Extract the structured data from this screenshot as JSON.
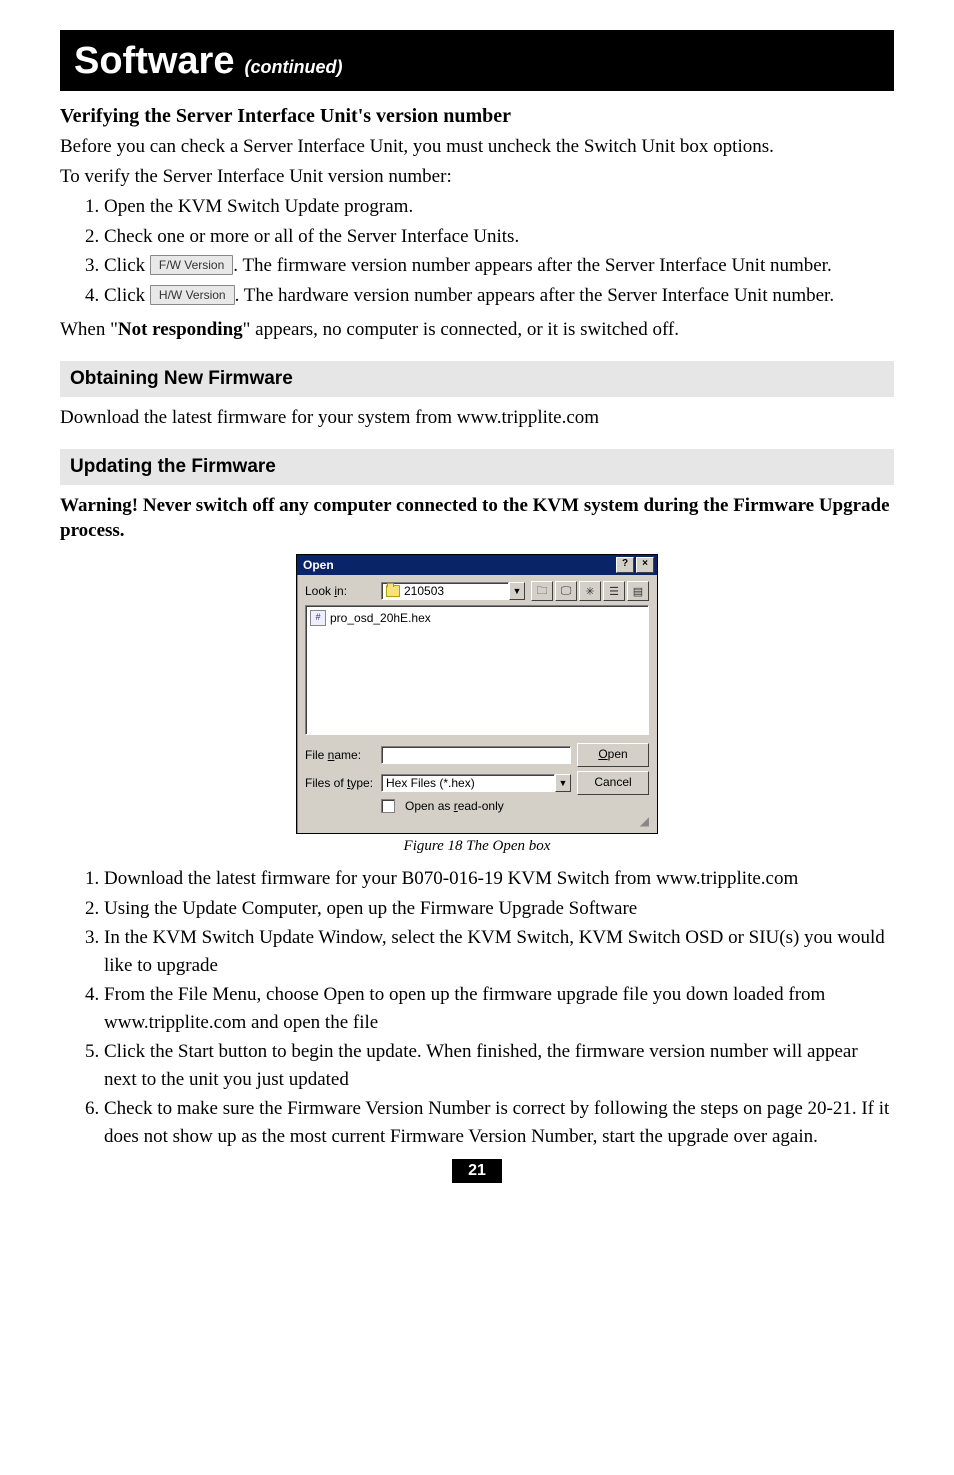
{
  "title": {
    "main": "Software",
    "sub": "(continued)"
  },
  "verify": {
    "heading": "Verifying the Server Interface Unit's version number",
    "p1": "Before you can check a Server Interface Unit, you must uncheck the Switch Unit box options.",
    "p2": "To verify the Server Interface Unit version number:",
    "steps": {
      "s1": "Open the KVM Switch Update program.",
      "s2": "Check one or more or all of the Server Interface Units.",
      "s3a": "Click ",
      "s3btn": "F/W Version",
      "s3b": ". The firmware version number appears after the Server Interface Unit number.",
      "s4a": "Click ",
      "s4btn": "H/W Version",
      "s4b": ". The hardware version number appears after the Server Interface Unit number."
    },
    "p3a": "When \"",
    "p3b": "Not responding",
    "p3c": "\" appears, no computer is connected, or it is switched off."
  },
  "section_obtain": {
    "heading": "Obtaining New Firmware",
    "p1": "Download the latest firmware for your system from www.tripplite.com"
  },
  "section_update": {
    "heading": "Updating the Firmware",
    "warn": "Warning! Never switch off any computer connected to the KVM system during the Firmware Upgrade process."
  },
  "dialog": {
    "title": "Open",
    "help_btn": "?",
    "close_btn": "×",
    "lookin_label": "Look in:",
    "lookin_value": "210503",
    "file_item": "pro_osd_20hE.hex",
    "filename_label": "File name:",
    "filename_value": "",
    "filetype_label": "Files of type:",
    "filetype_value": "Hex Files (*.hex)",
    "open_btn_u": "O",
    "open_btn_rest": "pen",
    "cancel_btn": "Cancel",
    "readonly_label": "Open as read-only"
  },
  "figure_caption": "Figure 18 The Open box",
  "update_steps": {
    "s1": "Download the latest firmware for your B070-016-19 KVM Switch from www.tripplite.com",
    "s2": "Using the Update Computer, open up the Firmware Upgrade Software",
    "s3": "In the KVM Switch Update Window, select the KVM Switch, KVM Switch OSD or SIU(s) you would like to upgrade",
    "s4": "From the File Menu, choose Open to open up the firmware upgrade file you down loaded from www.tripplite.com and open the file",
    "s5": "Click the Start button to begin the update. When finished, the firmware version number will appear next to the unit you just updated",
    "s6": "Check to make sure the Firmware Version Number is correct by following the steps on page 20-21. If it does not show up as the most current Firmware Version Number, start the upgrade over again."
  },
  "page_number": "21"
}
